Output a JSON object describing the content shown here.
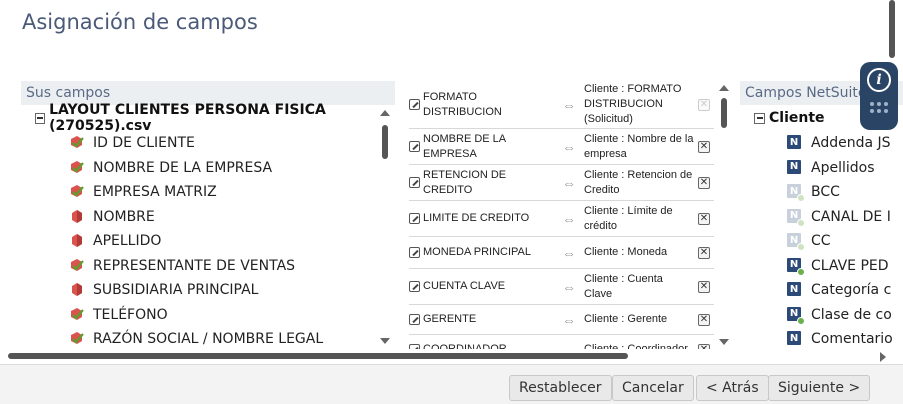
{
  "page": {
    "title": "Asignación de campos"
  },
  "left": {
    "header": "Sus campos",
    "root": "LAYOUT CLIENTES PERSONA FISICA (270525).csv",
    "fields": [
      {
        "label": "ID DE CLIENTE",
        "icon": "mapped-field-icon"
      },
      {
        "label": "NOMBRE DE LA EMPRESA",
        "icon": "mapped-field-icon"
      },
      {
        "label": "EMPRESA MATRIZ",
        "icon": "mapped-field-icon"
      },
      {
        "label": "NOMBRE",
        "icon": "unmapped-field-icon"
      },
      {
        "label": "APELLIDO",
        "icon": "unmapped-field-icon"
      },
      {
        "label": "REPRESENTANTE DE VENTAS",
        "icon": "mapped-field-icon"
      },
      {
        "label": "SUBSIDIARIA PRINCIPAL",
        "icon": "unmapped-field-icon"
      },
      {
        "label": "TELÉFONO",
        "icon": "mapped-field-icon"
      },
      {
        "label": "RAZÓN SOCIAL / NOMBRE LEGAL",
        "icon": "mapped-field-icon"
      }
    ]
  },
  "mappings": [
    {
      "source": "FORMATO DISTRIBUCION",
      "target": "Cliente : FORMATO DISTRIBUCION (Solicitud)",
      "remove_enabled": false
    },
    {
      "source": "NOMBRE DE LA EMPRESA",
      "target": "Cliente : Nombre de la empresa",
      "remove_enabled": true
    },
    {
      "source": "RETENCION DE CREDITO",
      "target": "Cliente : Retencion de Credito",
      "remove_enabled": true
    },
    {
      "source": "LIMITE DE CREDITO",
      "target": "Cliente : Límite de crédito",
      "remove_enabled": true
    },
    {
      "source": "MONEDA PRINCIPAL",
      "target": "Cliente : Moneda",
      "remove_enabled": true
    },
    {
      "source": "CUENTA CLAVE",
      "target": "Cliente : Cuenta Clave",
      "remove_enabled": true
    },
    {
      "source": "GERENTE",
      "target": "Cliente : Gerente",
      "remove_enabled": true
    },
    {
      "source": "COORDINADOR",
      "target": "Cliente : Coordinador",
      "remove_enabled": true
    }
  ],
  "right": {
    "header": "Campos NetSuite",
    "root": "Cliente",
    "fields": [
      {
        "label": "Addenda JS",
        "faded": false,
        "locked": false
      },
      {
        "label": "Apellidos",
        "faded": false,
        "locked": false
      },
      {
        "label": "BCC",
        "faded": true,
        "locked": true
      },
      {
        "label": "CANAL DE I",
        "faded": true,
        "locked": true
      },
      {
        "label": "CC",
        "faded": true,
        "locked": true
      },
      {
        "label": "CLAVE PED",
        "faded": false,
        "locked": true
      },
      {
        "label": "Categoría c",
        "faded": false,
        "locked": false
      },
      {
        "label": "Clase de co",
        "faded": false,
        "locked": true
      },
      {
        "label": "Comentario",
        "faded": false,
        "locked": false
      }
    ]
  },
  "footer": {
    "reset": "Restablecer",
    "cancel": "Cancelar",
    "back": "< Atrás",
    "next": "Siguiente >"
  },
  "icons": {
    "info": "i",
    "remove": "✕",
    "bidirectional_arrow": "⇔"
  },
  "colors": {
    "title": "#4a5a78",
    "header_bg": "#eceff2",
    "help_widget": "#2a4466",
    "netsuite_icon": "#2c4a78"
  }
}
